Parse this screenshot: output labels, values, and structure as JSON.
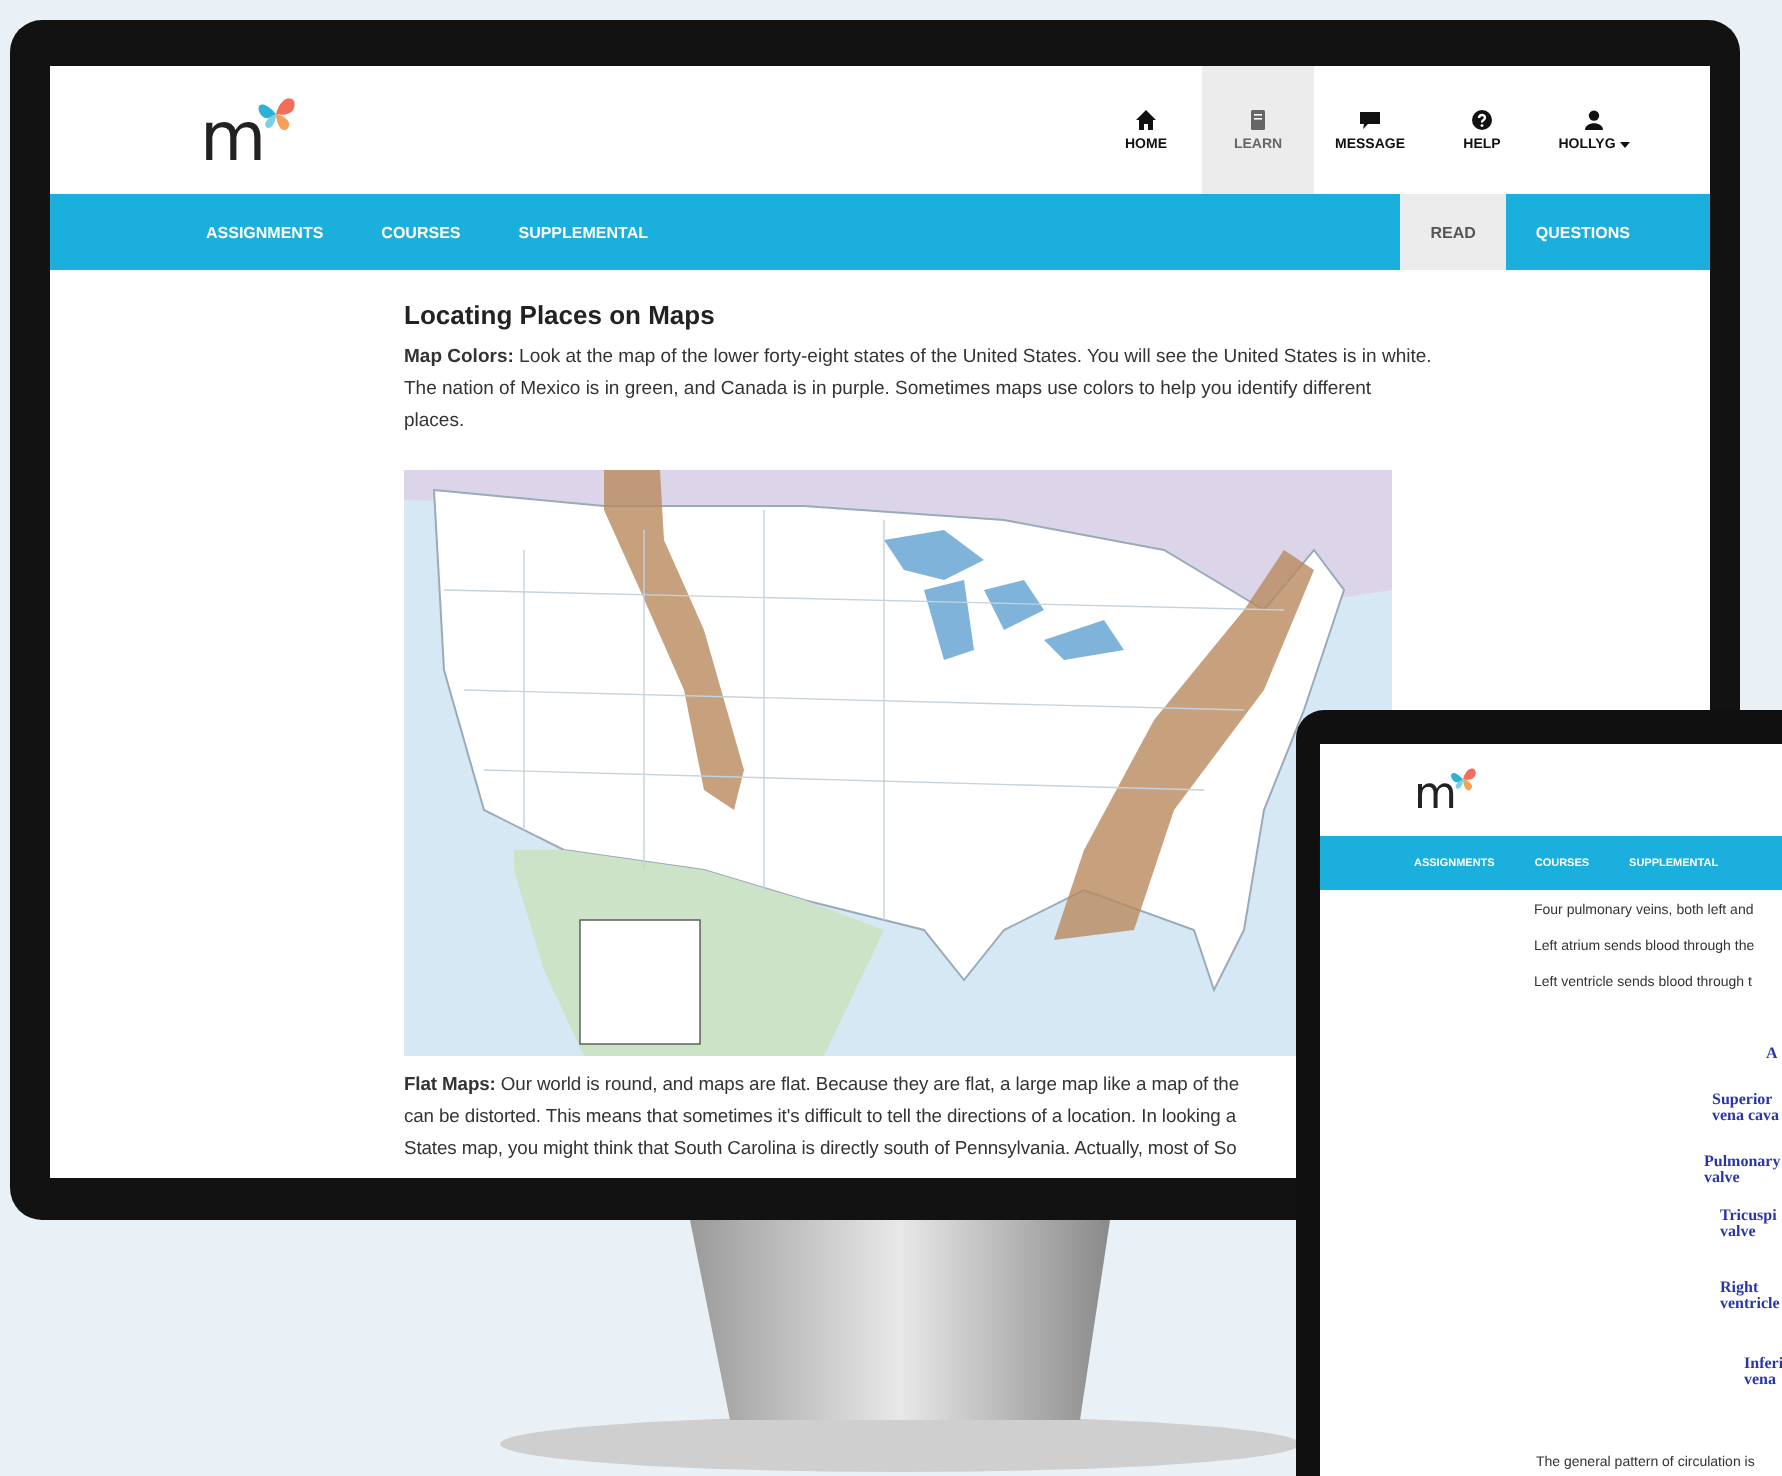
{
  "header": {
    "logo_text": "m",
    "nav": [
      {
        "label": "HOME",
        "kind": "home",
        "selected": false,
        "dropdown": false
      },
      {
        "label": "LEARN",
        "kind": "book",
        "selected": true,
        "dropdown": false
      },
      {
        "label": "MESSAGE",
        "kind": "chat",
        "selected": false,
        "dropdown": false
      },
      {
        "label": "HELP",
        "kind": "help",
        "selected": false,
        "dropdown": false
      },
      {
        "label": "HOLLYG",
        "kind": "user",
        "selected": false,
        "dropdown": true
      }
    ]
  },
  "subnav": {
    "left": [
      "ASSIGNMENTS",
      "COURSES",
      "SUPPLEMENTAL"
    ],
    "right": [
      {
        "label": "READ",
        "selected": true
      },
      {
        "label": "QUESTIONS",
        "selected": false
      }
    ]
  },
  "lesson": {
    "title": "Locating Places on Maps",
    "intro": "**Map Colors:** Look at the map of the lower forty-eight states of the United States. You will see the United States is in white. The nation of Mexico is in green, and Canada is in purple. Sometimes maps use colors to help you identify different places.",
    "flat_maps_lines": [
      "**Flat Maps:** Our world is round, and maps are flat. Because they are flat, a large map like a map of the",
      "can be distorted. This means that sometimes it's difficult to tell the directions of a location. In looking a",
      "States map, you might think that South Carolina is directly south of Pennsylvania. Actually, most of So"
    ]
  },
  "tablet": {
    "logo_text": "m",
    "nav": [
      "ASSIGNMENTS",
      "COURSES",
      "SUPPLEMENTAL"
    ],
    "lines": [
      "Four pulmonary veins, both left and",
      "Left atrium sends blood through the",
      "Left ventricle sends blood through t"
    ],
    "diagram_labels": [
      {
        "lines": [
          "A"
        ]
      },
      {
        "lines": [
          "Superior",
          "vena cava"
        ]
      },
      {
        "lines": [
          "Pulmonary",
          "valve"
        ]
      },
      {
        "lines": [
          "Tricuspi",
          "valve"
        ]
      },
      {
        "lines": [
          "Right",
          "ventricle"
        ]
      },
      {
        "lines": [
          "Inferi",
          "vena"
        ]
      }
    ],
    "footer": "The general pattern of circulation is"
  }
}
